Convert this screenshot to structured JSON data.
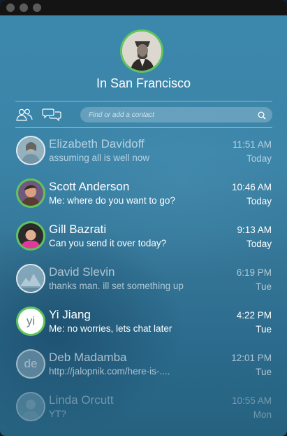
{
  "profile": {
    "location": "In San Francisco",
    "icon": "profile-photo"
  },
  "toolbar": {
    "contacts_icon": "people-icon",
    "chat_icon": "chat-bubbles-icon"
  },
  "search": {
    "placeholder": "Find or add a contact",
    "value": ""
  },
  "conversations": [
    {
      "name": "Elizabeth Davidoff",
      "preview": "assuming all is well now",
      "time": "11:51 AM",
      "day": "Today",
      "status": "read"
    },
    {
      "name": "Scott Anderson",
      "preview": "Me: where do you want to go?",
      "time": "10:46 AM",
      "day": "Today",
      "status": "online"
    },
    {
      "name": "Gill Bazrati",
      "preview": "Can you send it over today?",
      "time": "9:13 AM",
      "day": "Today",
      "status": "online"
    },
    {
      "name": "David Slevin",
      "preview": "thanks man. ill set something up",
      "time": "6:19 PM",
      "day": "Tue",
      "status": "read"
    },
    {
      "name": "Yi Jiang",
      "preview": "Me: no worries, lets chat later",
      "time": "4:22 PM",
      "day": "Tue",
      "status": "online",
      "initials": "yi"
    },
    {
      "name": "Deb Madamba",
      "preview": "http://jalopnik.com/here-is-....",
      "time": "12:01 PM",
      "day": "Tue",
      "status": "read",
      "initials": "de"
    },
    {
      "name": "Linda Orcutt",
      "preview": "YT?",
      "time": "10:55 AM",
      "day": "Mon",
      "status": "dim"
    }
  ],
  "colors": {
    "online_ring": "#5fc45d",
    "background": "#3b84a8",
    "titlebar": "#141414"
  }
}
